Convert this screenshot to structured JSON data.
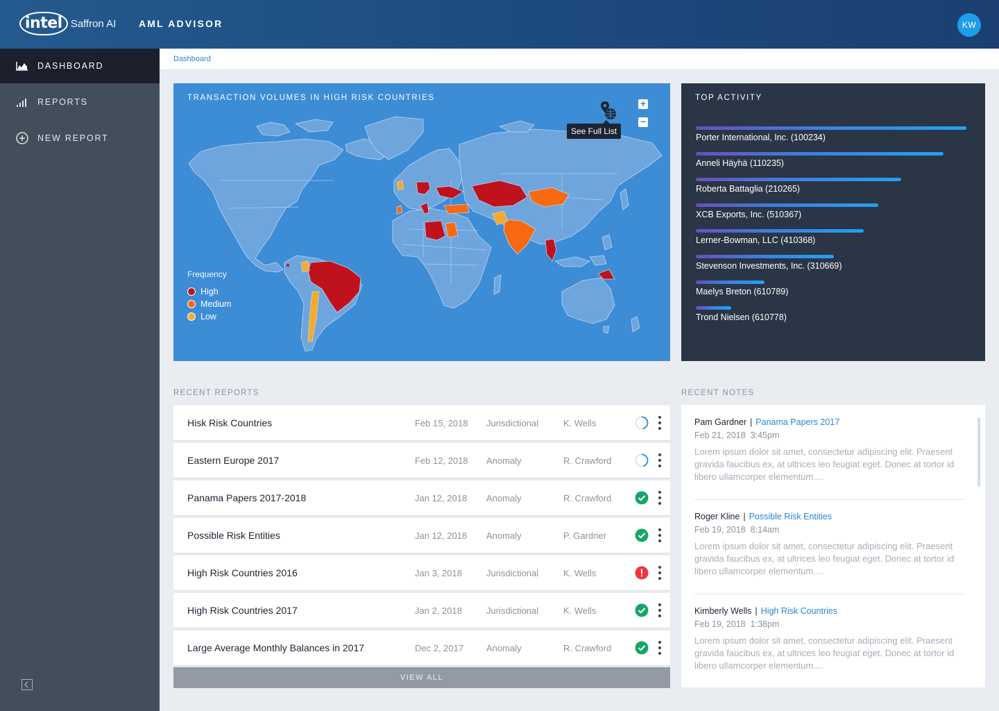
{
  "header": {
    "brand_intel": "intel",
    "brand_product": "Saffron AI",
    "app_title": "AML ADVISOR",
    "avatar_initials": "KW"
  },
  "sidebar": {
    "items": [
      {
        "label": "DASHBOARD",
        "icon": "area-chart-icon",
        "active": true
      },
      {
        "label": "REPORTS",
        "icon": "signal-bars-icon",
        "active": false
      },
      {
        "label": "NEW REPORT",
        "icon": "plus-circle-icon",
        "active": false
      }
    ],
    "collapse_icon": "collapse-sidebar-icon"
  },
  "breadcrumb": {
    "current": "Dashboard"
  },
  "map": {
    "title": "TRANSACTION VOLUMES IN HIGH RISK COUNTRIES",
    "tooltip": "See Full List",
    "zoom_in": "+",
    "zoom_out": "−",
    "legend": {
      "title": "Frequency",
      "items": [
        {
          "label": "High",
          "color": "#c0121d"
        },
        {
          "label": "Medium",
          "color": "#f76a12"
        },
        {
          "label": "Low",
          "color": "#f7a928"
        }
      ]
    }
  },
  "top_activity": {
    "title": "TOP ACTIVITY",
    "items": [
      {
        "label": "Porter International, Inc. (100234)",
        "value": 1.0
      },
      {
        "label": "Anneli Häyhä (110235)",
        "value": 0.915
      },
      {
        "label": "Roberta Battaglia (210265)",
        "value": 0.76
      },
      {
        "label": "XCB Exports, Inc. (510367)",
        "value": 0.675
      },
      {
        "label": "Lerner-Bowman, LLC (410368)",
        "value": 0.62
      },
      {
        "label": "Stevenson Investments, Inc. (310669)",
        "value": 0.51
      },
      {
        "label": "Maelys Breton (610789)",
        "value": 0.255
      },
      {
        "label": "Trond Nielsen (610778)",
        "value": 0.13
      }
    ]
  },
  "recent_reports": {
    "title": "RECENT REPORTS",
    "rows": [
      {
        "name": "Hisk Risk Countries",
        "date": "Feb 15, 2018",
        "type": "Jurisdictional",
        "owner": "K. Wells",
        "status": "in-progress"
      },
      {
        "name": "Eastern Europe 2017",
        "date": "Feb 12, 2018",
        "type": "Anomaly",
        "owner": "R. Crawford",
        "status": "in-progress"
      },
      {
        "name": "Panama Papers 2017-2018",
        "date": "Jan 12, 2018",
        "type": "Anomaly",
        "owner": "R. Crawford",
        "status": "complete"
      },
      {
        "name": "Possible Risk Entities",
        "date": "Jan 12, 2018",
        "type": "Anomaly",
        "owner": "P. Gardner",
        "status": "complete"
      },
      {
        "name": "High Risk Countries 2016",
        "date": "Jan 3, 2018",
        "type": "Jurisdictional",
        "owner": "K. Wells",
        "status": "error"
      },
      {
        "name": "High Risk Countries 2017",
        "date": "Jan 2, 2018",
        "type": "Jurisdictional",
        "owner": "K. Wells",
        "status": "complete"
      },
      {
        "name": "Large Average Monthly Balances in 2017",
        "date": "Dec 2, 2017",
        "type": "Anomaly",
        "owner": "R. Crawford",
        "status": "complete"
      }
    ],
    "view_all": "VIEW ALL",
    "status_colors": {
      "complete": "#17a567",
      "error": "#f0353f",
      "in-progress": "#2a86d6"
    }
  },
  "recent_notes": {
    "title": "RECENT NOTES",
    "notes": [
      {
        "author": "Pam Gardner",
        "separator": "|",
        "link": "Panama Papers 2017",
        "date": "Feb 21, 2018",
        "time": "3:45pm",
        "body": "Lorem ipsum dolor sit amet, consectetur adipiscing elit. Praesent gravida faucibus ex, at ultrices leo feugiat eget. Donec at tortor id libero ullamcorper elementum...."
      },
      {
        "author": "Roger Kline",
        "separator": "|",
        "link": "Possible Risk Entities",
        "date": "Feb 19, 2018",
        "time": "8:14am",
        "body": "Lorem ipsum dolor sit amet, consectetur adipiscing elit. Praesent gravida faucibus ex, at ultrices leo feugiat eget. Donec at tortor id libero ullamcorper elementum...."
      },
      {
        "author": "Kimberly Wells",
        "separator": "|",
        "link": "High Risk Countries",
        "date": "Feb 19, 2018",
        "time": "1:38pm",
        "body": "Lorem ipsum dolor sit amet, consectetur adipiscing elit. Praesent gravida faucibus ex, at ultrices leo feugiat eget. Donec at tortor id libero ullamcorper elementum...."
      }
    ]
  }
}
